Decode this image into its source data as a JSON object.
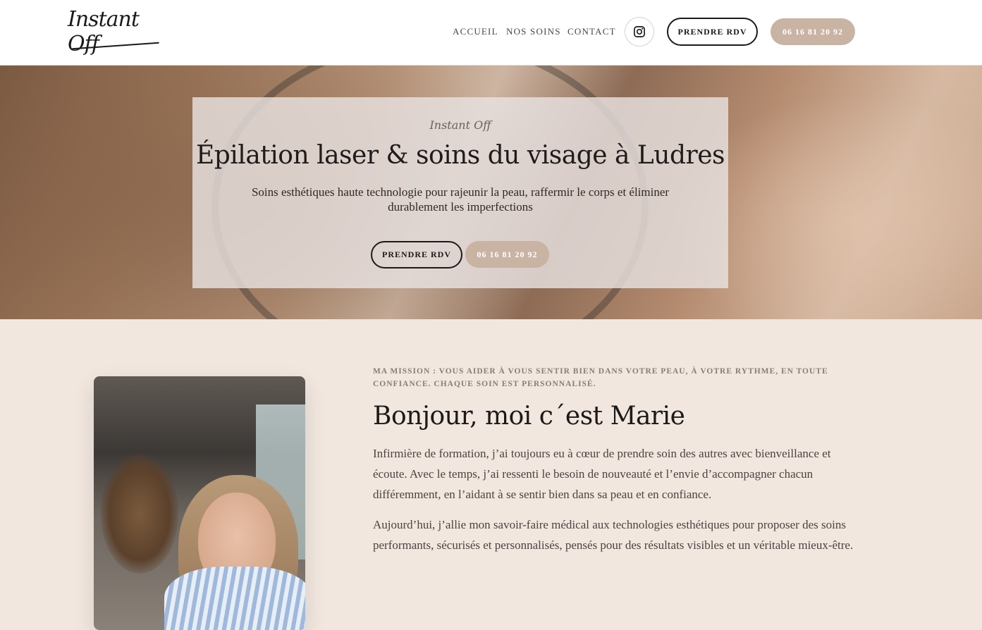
{
  "header": {
    "logo_text": "Instant Off",
    "nav": [
      "ACCUEIL",
      "NOS SOINS",
      "CONTACT"
    ],
    "instagram_icon": "instagram-icon",
    "cta_rdv": "PRENDRE RDV",
    "cta_phone": "06 16 81 20 92"
  },
  "hero": {
    "kicker": "Instant Off",
    "title": "Épilation laser & soins du visage à Ludres",
    "subtitle": "Soins esthétiques haute technologie pour rajeunir la peau, raffermir le corps et éliminer durablement les imperfections",
    "cta_rdv": "PRENDRE RDV",
    "cta_phone": "06 16 81 20 92"
  },
  "about": {
    "mission": "MA MISSION : VOUS AIDER À VOUS SENTIR BIEN DANS VOTRE PEAU, À VOTRE RYTHME, EN TOUTE CONFIANCE. CHAQUE SOIN EST PERSONNALISÉ.",
    "title": "Bonjour, moi c´est Marie",
    "paragraph1": "Infirmière de formation, j’ai toujours eu à cœur de prendre soin des autres avec bienveillance et écoute. Avec le temps, j’ai ressenti le besoin de nouveauté et l’envie d’accompagner chacun différemment, en l’aidant à se sentir bien dans sa peau et en confiance.",
    "paragraph2": "Aujourd’hui, j’allie mon savoir-faire médical aux technologies esthétiques pour proposer des soins performants, sécurisés et personnalisés, pensés pour des résultats visibles et un véritable mieux-être."
  },
  "colors": {
    "accent": "#c9b3a3",
    "background": "#f1e7df",
    "text": "#1c1a19"
  }
}
